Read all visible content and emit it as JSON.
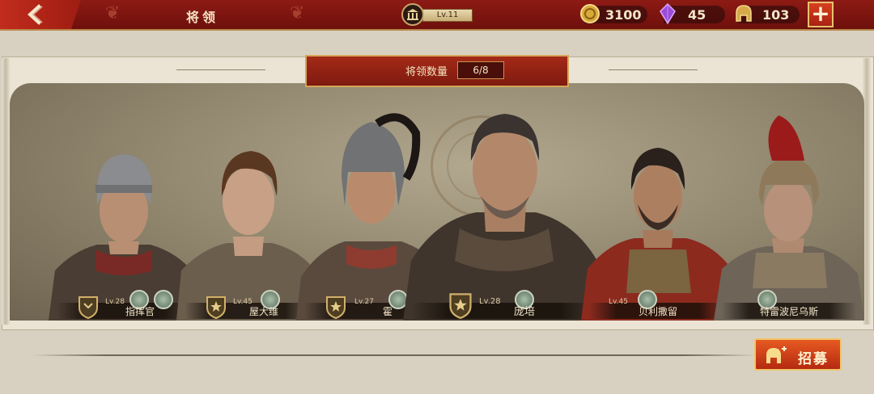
{
  "header": {
    "title": "将领",
    "level_label": "Lv.11",
    "gold": "3100",
    "gems": "45",
    "honor": "103",
    "plus_label": "+"
  },
  "panel": {
    "count_label": "将领数量",
    "count_value": "6/8"
  },
  "generals": [
    {
      "name": "指挥官",
      "level": "Lv.28"
    },
    {
      "name": "屋大维",
      "level": "Lv.45"
    },
    {
      "name": "霍",
      "level": "Lv.27"
    },
    {
      "name": "庞培",
      "level": "Lv.28"
    },
    {
      "name": "贝利撒留",
      "level": "Lv.45"
    },
    {
      "name": "特雷波尼乌斯",
      "level": ""
    }
  ],
  "actions": {
    "recruit_label": "招募"
  },
  "colors": {
    "topbar": "#7e140f",
    "accent_gold": "#d6a657",
    "recruit": "#d4401a"
  }
}
